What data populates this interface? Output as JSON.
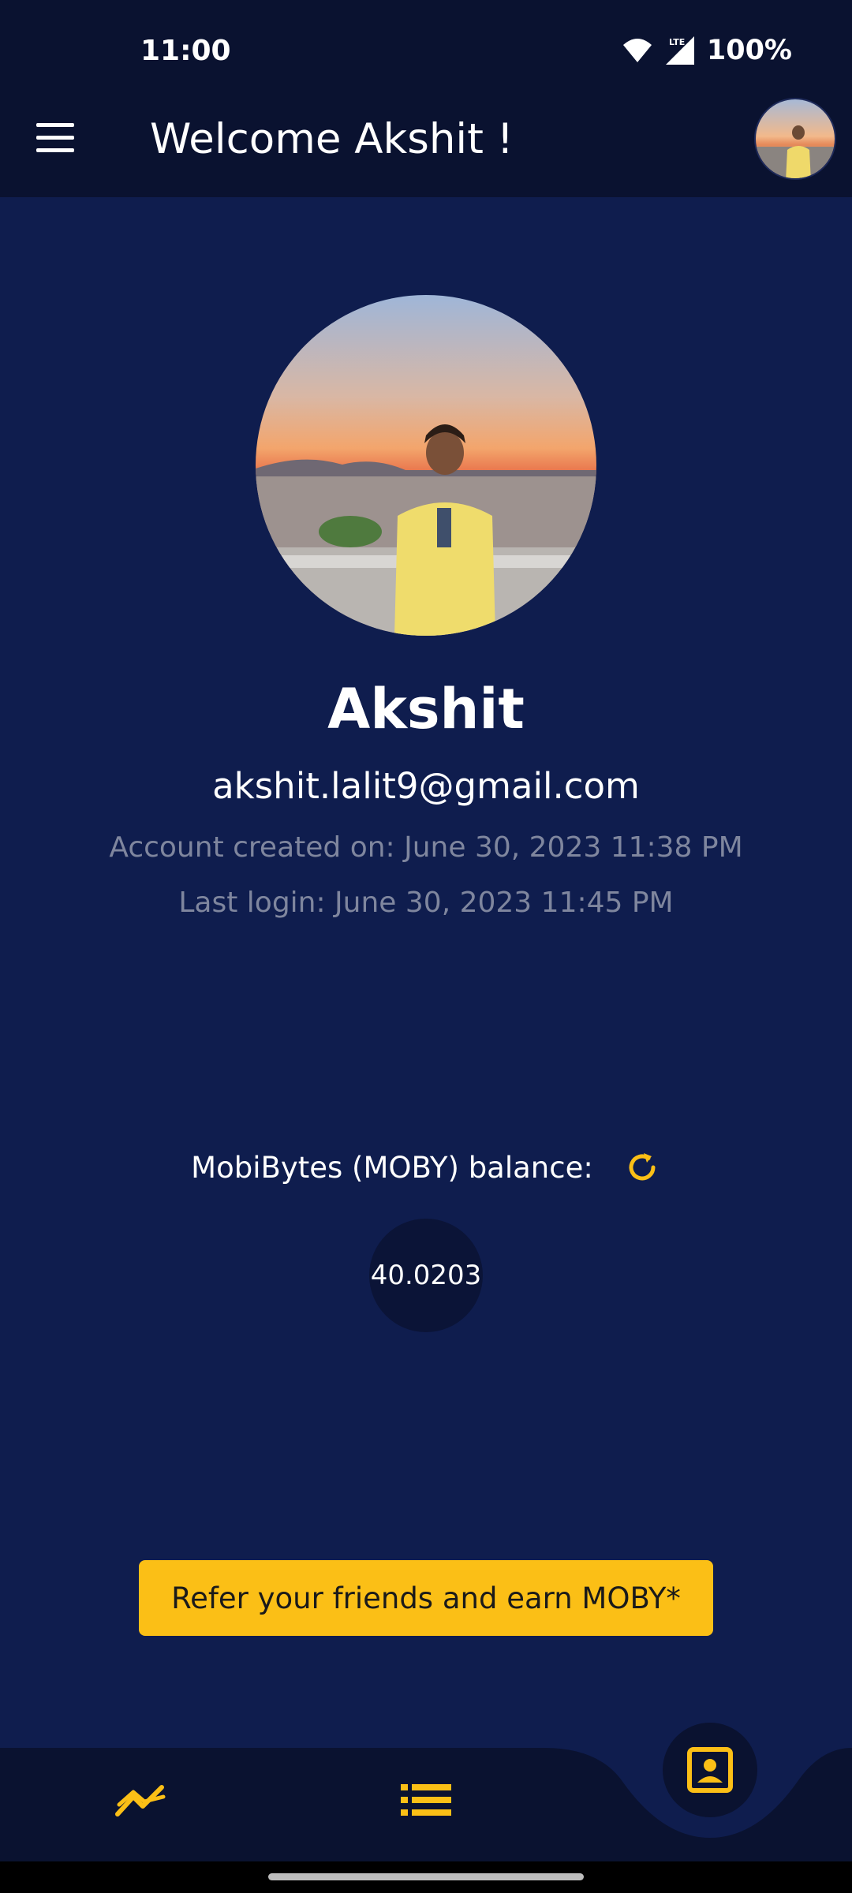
{
  "status_bar": {
    "time": "11:00",
    "battery": "100%",
    "network_label": "LTE",
    "icons": [
      "wifi-icon",
      "signal-icon"
    ]
  },
  "app_bar": {
    "title": "Welcome Akshit !",
    "menu_icon": "hamburger-menu-icon"
  },
  "profile": {
    "name": "Akshit",
    "email": "akshit.lalit9@gmail.com",
    "account_created": "Account created on: June 30, 2023 11:38 PM",
    "last_login": "Last login: June 30, 2023 11:45 PM"
  },
  "balance": {
    "label": "MobiBytes (MOBY) balance:",
    "value": "40.0203",
    "refresh_icon": "refresh-icon"
  },
  "refer": {
    "label": "Refer your friends and earn MOBY*"
  },
  "bottom_nav": {
    "items": [
      "trending-icon",
      "list-icon",
      "profile-icon"
    ],
    "active": "profile"
  },
  "colors": {
    "background": "#0f1d4e",
    "bar": "#0a1230",
    "accent": "#fbbf16",
    "muted_text": "#7f869e"
  }
}
